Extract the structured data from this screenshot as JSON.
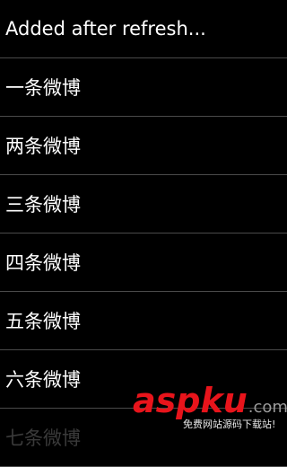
{
  "list": {
    "items": [
      {
        "label": "Added after refresh..."
      },
      {
        "label": "一条微博"
      },
      {
        "label": "两条微博"
      },
      {
        "label": "三条微博"
      },
      {
        "label": "四条微博"
      },
      {
        "label": "五条微博"
      },
      {
        "label": "六条微博"
      },
      {
        "label": "七条微博"
      }
    ]
  },
  "watermark": {
    "brand_asp": "asp",
    "brand_ku": "ku",
    "brand_com": ".com",
    "tagline": "免费网站源码下载站!"
  },
  "colors": {
    "background": "#000000",
    "text": "#ffffff",
    "divider": "#4a4a4a",
    "watermark_red": "#e8141b"
  }
}
